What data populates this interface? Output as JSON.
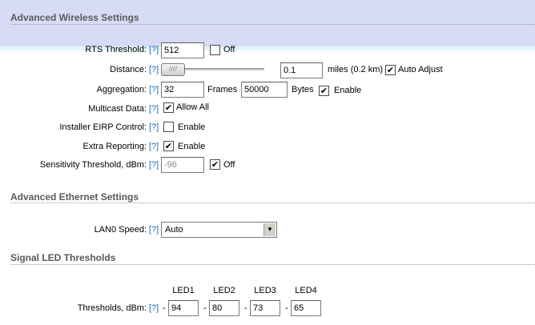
{
  "sections": {
    "wireless_title": "Advanced Wireless Settings",
    "ethernet_title": "Advanced Ethernet Settings",
    "led_title": "Signal LED Thresholds"
  },
  "help_text": "[?]",
  "rts": {
    "label": "RTS Threshold:",
    "value": "512",
    "off_label": "Off",
    "off_checked": false
  },
  "distance": {
    "label": "Distance:",
    "value": "0.1",
    "unit_text": "miles (0.2 km)",
    "auto_label": "Auto Adjust",
    "auto_checked": true,
    "slider_thumb_glyph": "////"
  },
  "aggregation": {
    "label": "Aggregation:",
    "frames_value": "32",
    "frames_label": "Frames",
    "bytes_value": "50000",
    "bytes_label": "Bytes",
    "enable_label": "Enable",
    "enable_checked": true
  },
  "multicast": {
    "label": "Multicast Data:",
    "allow_label": "Allow All",
    "checked": true
  },
  "installer_eirp": {
    "label": "Installer EIRP Control:",
    "enable_label": "Enable",
    "checked": false
  },
  "extra_reporting": {
    "label": "Extra Reporting:",
    "enable_label": "Enable",
    "checked": true
  },
  "sensitivity": {
    "label": "Sensitivity Threshold, dBm:",
    "value": "-96",
    "off_label": "Off",
    "off_checked": true
  },
  "lan0": {
    "label": "LAN0 Speed:",
    "selected": "Auto"
  },
  "led": {
    "headers": [
      "LED1",
      "LED2",
      "LED3",
      "LED4"
    ],
    "label": "Thresholds, dBm:",
    "prefix": "-",
    "values": [
      "94",
      "80",
      "73",
      "65"
    ]
  },
  "check_glyph": "✔"
}
